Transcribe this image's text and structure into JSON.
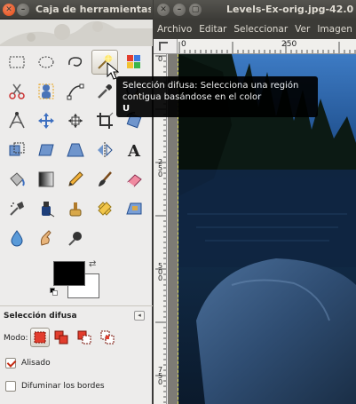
{
  "toolbox": {
    "title": "Caja de herramientas",
    "tools": [
      {
        "name": "rect-select-icon"
      },
      {
        "name": "ellipse-select-icon"
      },
      {
        "name": "free-select-icon"
      },
      {
        "name": "fuzzy-select-icon",
        "active": true
      },
      {
        "name": "select-by-color-icon"
      },
      {
        "name": "scissors-select-icon"
      },
      {
        "name": "foreground-select-icon"
      },
      {
        "name": "paths-icon"
      },
      {
        "name": "color-picker-icon"
      },
      {
        "name": "zoom-icon"
      },
      {
        "name": "measure-icon"
      },
      {
        "name": "move-icon"
      },
      {
        "name": "align-icon"
      },
      {
        "name": "crop-icon"
      },
      {
        "name": "rotate-icon"
      },
      {
        "name": "scale-icon"
      },
      {
        "name": "shear-icon"
      },
      {
        "name": "perspective-icon"
      },
      {
        "name": "flip-icon"
      },
      {
        "name": "text-icon"
      },
      {
        "name": "bucket-fill-icon"
      },
      {
        "name": "blend-icon"
      },
      {
        "name": "pencil-icon"
      },
      {
        "name": "paintbrush-icon"
      },
      {
        "name": "eraser-icon"
      },
      {
        "name": "airbrush-icon"
      },
      {
        "name": "ink-icon"
      },
      {
        "name": "clone-icon"
      },
      {
        "name": "heal-icon"
      },
      {
        "name": "perspective-clone-icon"
      },
      {
        "name": "blur-icon"
      },
      {
        "name": "smudge-icon"
      },
      {
        "name": "dodge-burn-icon"
      }
    ],
    "colors": {
      "foreground": "#000000",
      "background": "#ffffff"
    },
    "options": {
      "title": "Selección difusa",
      "mode_label": "Modo:",
      "antialias_label": "Alisado",
      "antialias_checked": true,
      "feather_label": "Difuminar los bordes",
      "feather_checked": false
    }
  },
  "image_window": {
    "title": "Levels-Ex-orig.jpg-42.0 (",
    "menu": [
      "Archivo",
      "Editar",
      "Seleccionar",
      "Ver",
      "Imagen"
    ],
    "ruler_top_labels": [
      "0",
      "250"
    ],
    "ruler_left_labels": [
      "0",
      "2\n5\n0",
      "5\n0\n0",
      "7\n5\n0"
    ]
  },
  "tooltip": {
    "text": "Selección difusa: Selecciona una región contigua basándose en el color",
    "shortcut": "U"
  }
}
